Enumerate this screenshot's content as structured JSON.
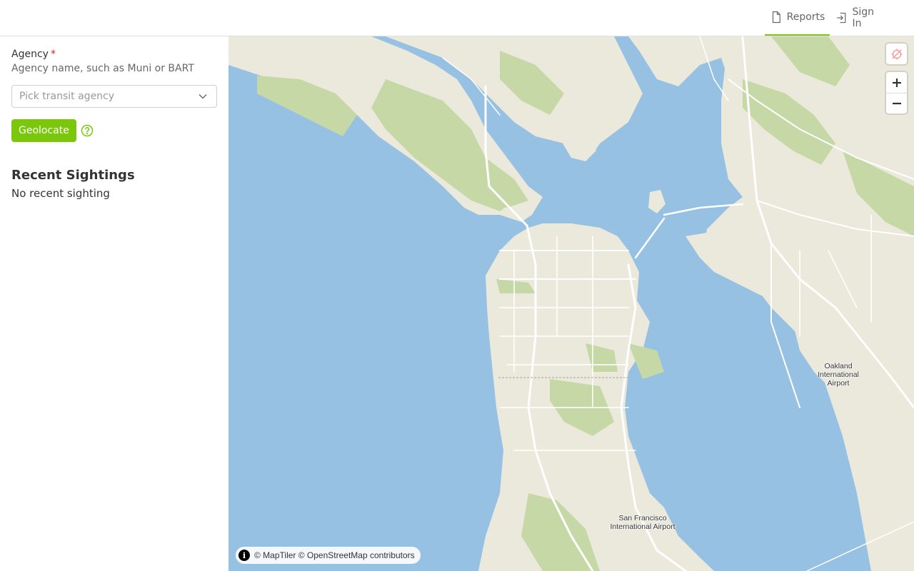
{
  "nav": {
    "reports_label": "Reports",
    "signin_label": "Sign In",
    "accent_color": "#7ac70c"
  },
  "form": {
    "agency_label": "Agency",
    "required_mark": "*",
    "agency_help": "Agency name, such as Muni or BART",
    "agency_placeholder": "Pick transit agency",
    "geolocate_label": "Geolocate"
  },
  "sightings": {
    "title": "Recent Sightings",
    "empty_text": "No recent sighting"
  },
  "map": {
    "labels": {
      "oakland_airport": "Oakland International Airport",
      "sfo": "San Francisco International Airport"
    },
    "attribution": "© MapTiler © OpenStreetMap contributors",
    "colors": {
      "water": "#97c1e2",
      "land": "#ebe8dc",
      "park": "#c6d8a6",
      "road": "#ffffff"
    },
    "icons": {
      "locate": "location-off-icon",
      "zoom_in": "plus-icon",
      "zoom_out": "minus-icon",
      "info": "info-icon"
    }
  }
}
